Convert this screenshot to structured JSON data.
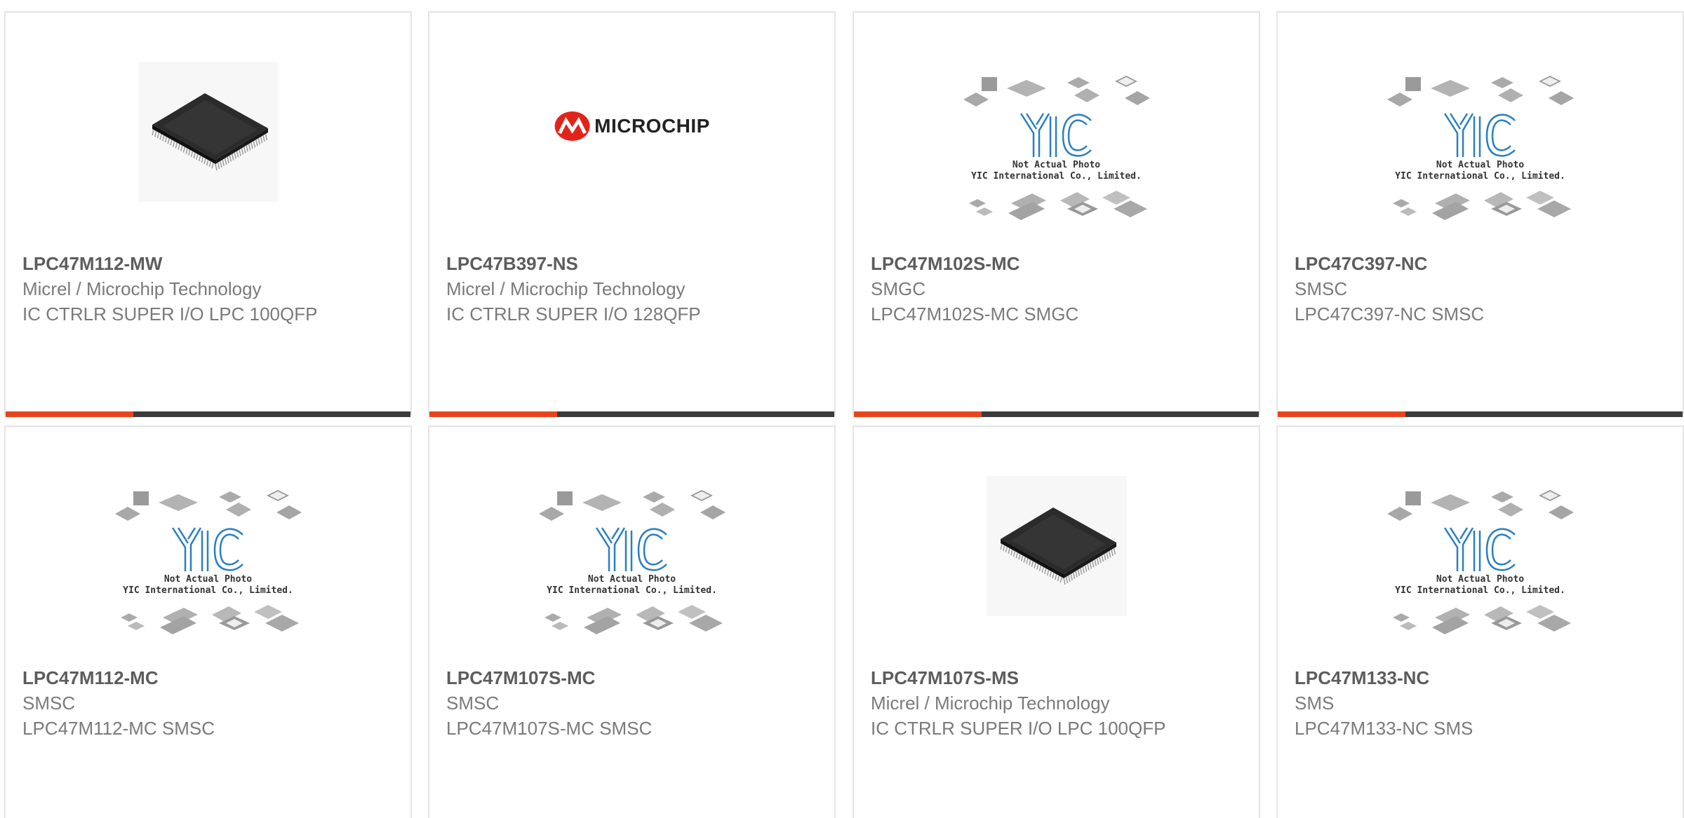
{
  "colors": {
    "accent": "#e8431d",
    "bar": "#3b3b3b",
    "title": "#5c5c5c",
    "text": "#7a7a7a",
    "border": "#e4e4e4"
  },
  "placeholder": {
    "note_line1": "Not Actual Photo",
    "note_line2": "YIC International Co., Limited.",
    "logo_text": "YIC"
  },
  "microchip_logo": {
    "text": "MICROCHIP"
  },
  "products": [
    {
      "part_number": "LPC47M112-MW",
      "manufacturer": "Micrel / Microchip Technology",
      "description": "IC CTRLR SUPER I/O LPC 100QFP",
      "image": "chip-photo"
    },
    {
      "part_number": "LPC47B397-NS",
      "manufacturer": "Micrel / Microchip Technology",
      "description": "IC CTRLR SUPER I/O 128QFP",
      "image": "microchip-logo"
    },
    {
      "part_number": "LPC47M102S-MC",
      "manufacturer": "SMGC",
      "description": "LPC47M102S-MC SMGC",
      "image": "placeholder"
    },
    {
      "part_number": "LPC47C397-NC",
      "manufacturer": "SMSC",
      "description": "LPC47C397-NC SMSC",
      "image": "placeholder"
    },
    {
      "part_number": "LPC47M112-MC",
      "manufacturer": "SMSC",
      "description": "LPC47M112-MC SMSC",
      "image": "placeholder"
    },
    {
      "part_number": "LPC47M107S-MC",
      "manufacturer": "SMSC",
      "description": "LPC47M107S-MC SMSC",
      "image": "placeholder"
    },
    {
      "part_number": "LPC47M107S-MS",
      "manufacturer": "Micrel / Microchip Technology",
      "description": "IC CTRLR SUPER I/O LPC 100QFP",
      "image": "chip-photo"
    },
    {
      "part_number": "LPC47M133-NC",
      "manufacturer": "SMS",
      "description": "LPC47M133-NC SMS",
      "image": "placeholder"
    }
  ]
}
